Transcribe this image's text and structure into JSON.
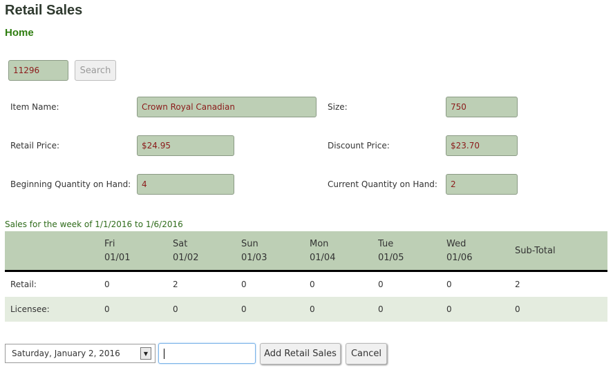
{
  "header": {
    "title": "Retail Sales",
    "home_link": "Home"
  },
  "search": {
    "value": "11296",
    "button": "Search"
  },
  "form": {
    "item_name_label": "Item Name:",
    "item_name": "Crown Royal Canadian",
    "size_label": "Size:",
    "size": "750",
    "retail_price_label": "Retail Price:",
    "retail_price": "$24.95",
    "discount_price_label": "Discount Price:",
    "discount_price": "$23.70",
    "beginning_qty_label": "Beginning Quantity on Hand:",
    "beginning_qty": "4",
    "current_qty_label": "Current Quantity on Hand:",
    "current_qty": "2"
  },
  "sales": {
    "caption": "Sales for the week of 1/1/2016 to 1/6/2016",
    "columns": [
      {
        "day": "Fri",
        "date": "01/01"
      },
      {
        "day": "Sat",
        "date": "01/02"
      },
      {
        "day": "Sun",
        "date": "01/03"
      },
      {
        "day": "Mon",
        "date": "01/04"
      },
      {
        "day": "Tue",
        "date": "01/05"
      },
      {
        "day": "Wed",
        "date": "01/06"
      }
    ],
    "subtotal_header": "Sub-Total",
    "rows": [
      {
        "label": "Retail:",
        "values": [
          "0",
          "2",
          "0",
          "0",
          "0",
          "0"
        ],
        "subtotal": "2"
      },
      {
        "label": "Licensee:",
        "values": [
          "0",
          "0",
          "0",
          "0",
          "0",
          "0"
        ],
        "subtotal": "0"
      }
    ]
  },
  "footer": {
    "date_selected": "Saturday, January 2, 2016",
    "quantity_value": "",
    "add_button": "Add Retail Sales",
    "cancel_button": "Cancel"
  },
  "icons": {
    "dropdown": "chevron-down-icon"
  },
  "colors": {
    "field_bg": "#bdcfb5",
    "field_text": "#8b1a1a",
    "accent_green": "#2e7d0f",
    "alt_row": "#e4ecdf"
  }
}
